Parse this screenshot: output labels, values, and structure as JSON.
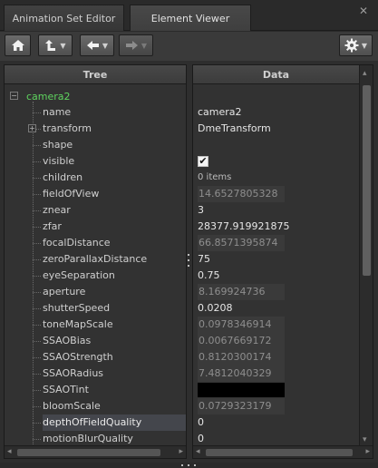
{
  "tabs": [
    {
      "label": "Animation Set Editor",
      "active": false
    },
    {
      "label": "Element Viewer",
      "active": true
    }
  ],
  "toolbar": {
    "icons": [
      "home-icon",
      "up-arrow-icon",
      "back-arrow-icon",
      "forward-arrow-icon",
      "gear-icon"
    ],
    "forward_disabled": true
  },
  "tree": {
    "header": "Tree",
    "root": "camera2",
    "items": [
      {
        "label": "name"
      },
      {
        "label": "transform",
        "expandable": true
      },
      {
        "label": "shape"
      },
      {
        "label": "visible"
      },
      {
        "label": "children"
      },
      {
        "label": "fieldOfView"
      },
      {
        "label": "znear"
      },
      {
        "label": "zfar"
      },
      {
        "label": "focalDistance"
      },
      {
        "label": "zeroParallaxDistance"
      },
      {
        "label": "eyeSeparation"
      },
      {
        "label": "aperture"
      },
      {
        "label": "shutterSpeed"
      },
      {
        "label": "toneMapScale"
      },
      {
        "label": "SSAOBias"
      },
      {
        "label": "SSAOStrength"
      },
      {
        "label": "SSAORadius"
      },
      {
        "label": "SSAOTint"
      },
      {
        "label": "bloomScale"
      },
      {
        "label": "depthOfFieldQuality",
        "selected": true
      },
      {
        "label": "motionBlurQuality"
      }
    ]
  },
  "data": {
    "header": "Data",
    "values": [
      {
        "kind": "text",
        "value": "camera2"
      },
      {
        "kind": "text",
        "value": "DmeTransform"
      },
      {
        "kind": "empty",
        "value": ""
      },
      {
        "kind": "checkbox",
        "value": "✔"
      },
      {
        "kind": "subtext",
        "value": "0 items"
      },
      {
        "kind": "grey",
        "value": "14.6527805328"
      },
      {
        "kind": "text",
        "value": "3"
      },
      {
        "kind": "text",
        "value": "28377.919921875"
      },
      {
        "kind": "grey",
        "value": "66.8571395874"
      },
      {
        "kind": "text",
        "value": "75"
      },
      {
        "kind": "text",
        "value": "0.75"
      },
      {
        "kind": "grey",
        "value": "8.169924736"
      },
      {
        "kind": "text",
        "value": "0.0208"
      },
      {
        "kind": "grey",
        "value": "0.0978346914"
      },
      {
        "kind": "grey",
        "value": "0.0067669172"
      },
      {
        "kind": "grey",
        "value": "0.8120300174"
      },
      {
        "kind": "grey",
        "value": "7.4812040329"
      },
      {
        "kind": "black",
        "value": ""
      },
      {
        "kind": "grey",
        "value": "0.0729323179"
      },
      {
        "kind": "text",
        "value": "0"
      },
      {
        "kind": "text",
        "value": "0"
      }
    ]
  },
  "colors": {
    "root_label": "#5ed35e",
    "selection": "#44464c"
  }
}
